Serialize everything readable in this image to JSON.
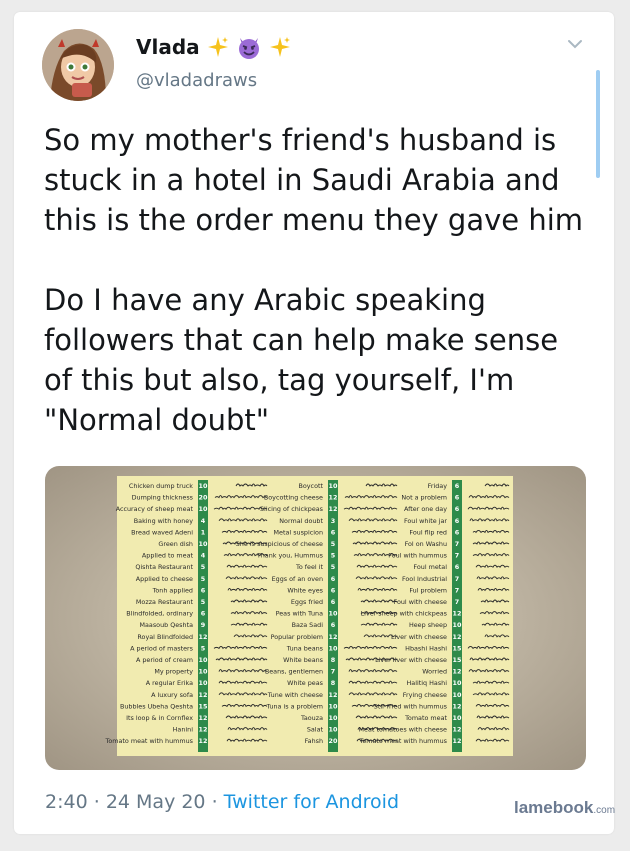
{
  "author": {
    "display_name": "Vlada",
    "handle": "@vladadraws",
    "name_emoji": [
      "sparkles",
      "smiling-imp",
      "sparkles"
    ]
  },
  "tweet": {
    "text": "So my mother's friend's husband is stuck in a hotel in Saudi Arabia and this is the order menu they gave him\n\nDo I have any Arabic speaking followers that can help make sense of this but also, tag yourself, I'm \"Normal doubt\""
  },
  "footer": {
    "time": "2:40",
    "separator1": "·",
    "date": "24 May 20",
    "separator2": "·",
    "client": "Twitter for Android"
  },
  "watermark": {
    "brand": "lamebook",
    "tld": ".com"
  },
  "menu": {
    "left": [
      {
        "en": "Chicken dump truck",
        "n": "10"
      },
      {
        "en": "Dumping thickness",
        "n": "20"
      },
      {
        "en": "Accuracy of sheep meat",
        "n": "10"
      },
      {
        "en": "Baking with honey",
        "n": "4"
      },
      {
        "en": "Bread waved Adeni",
        "n": "1"
      },
      {
        "en": "Green dish",
        "n": "10"
      },
      {
        "en": "Applied to meat",
        "n": "4"
      },
      {
        "en": "Qishta Restaurant",
        "n": "5"
      },
      {
        "en": "Applied to cheese",
        "n": "5"
      },
      {
        "en": "Tonh applied",
        "n": "6"
      },
      {
        "en": "Mozza Restaurant",
        "n": "5"
      },
      {
        "en": "Blindfolded, ordinary",
        "n": "6"
      },
      {
        "en": "Maasoub Qeshta",
        "n": "9"
      },
      {
        "en": "Royal Blindfolded",
        "n": "12"
      },
      {
        "en": "A period of masters",
        "n": "5"
      },
      {
        "en": "A period of cream",
        "n": "10"
      },
      {
        "en": "My property",
        "n": "10"
      },
      {
        "en": "A regular Erika",
        "n": "10"
      },
      {
        "en": "A luxury sofa",
        "n": "12"
      },
      {
        "en": "Bubbles Ubeha Qeshta",
        "n": "15"
      },
      {
        "en": "Its loop & in Cornflex",
        "n": "12"
      },
      {
        "en": "Hanini",
        "n": "12"
      },
      {
        "en": "Tomato meat with hummus",
        "n": "12"
      }
    ],
    "middle": [
      {
        "en": "Boycott",
        "n": "10"
      },
      {
        "en": "Boycotting cheese",
        "n": "12"
      },
      {
        "en": "Slicing of chickpeas",
        "n": "12"
      },
      {
        "en": "Normal doubt",
        "n": "3"
      },
      {
        "en": "Metal suspicion",
        "n": "6"
      },
      {
        "en": "She is suspicious of cheese",
        "n": "5"
      },
      {
        "en": "Thank you, Hummus",
        "n": "5"
      },
      {
        "en": "To feel it",
        "n": "5"
      },
      {
        "en": "Eggs of an oven",
        "n": "6"
      },
      {
        "en": "White eyes",
        "n": "6"
      },
      {
        "en": "Eggs fried",
        "n": "6"
      },
      {
        "en": "Peas with Tuna",
        "n": "10"
      },
      {
        "en": "Baza Sadi",
        "n": "6"
      },
      {
        "en": "Popular problem",
        "n": "12"
      },
      {
        "en": "Tuna beans",
        "n": "10"
      },
      {
        "en": "White beans",
        "n": "8"
      },
      {
        "en": "Beans, gentlemen",
        "n": "7"
      },
      {
        "en": "White peas",
        "n": "8"
      },
      {
        "en": "Tune with cheese",
        "n": "12"
      },
      {
        "en": "Tuna is a problem",
        "n": "10"
      },
      {
        "en": "Taouza",
        "n": "10"
      },
      {
        "en": "Salat",
        "n": "10"
      },
      {
        "en": "Fahsh",
        "n": "20"
      }
    ],
    "right": [
      {
        "en": "Friday",
        "n": "6"
      },
      {
        "en": "Not a problem",
        "n": "6"
      },
      {
        "en": "After one day",
        "n": "6"
      },
      {
        "en": "Foul white jar",
        "n": "6"
      },
      {
        "en": "Foul flip red",
        "n": "6"
      },
      {
        "en": "Fol on Washu",
        "n": "7"
      },
      {
        "en": "Foul with hummus",
        "n": "7"
      },
      {
        "en": "Foul metal",
        "n": "6"
      },
      {
        "en": "Fool Industrial",
        "n": "7"
      },
      {
        "en": "Ful problem",
        "n": "7"
      },
      {
        "en": "Foul with cheese",
        "n": "7"
      },
      {
        "en": "Liver sheep with chickpeas",
        "n": "12"
      },
      {
        "en": "Heep sheep",
        "n": "10"
      },
      {
        "en": "Liver with cheese",
        "n": "12"
      },
      {
        "en": "Hbashi Hashi",
        "n": "15"
      },
      {
        "en": "Liver liver with cheese",
        "n": "15"
      },
      {
        "en": "Worried",
        "n": "12"
      },
      {
        "en": "Halitiq Hashi",
        "n": "10"
      },
      {
        "en": "Frying cheese",
        "n": "10"
      },
      {
        "en": "Stir fried with hummus",
        "n": "12"
      },
      {
        "en": "Tomato meat",
        "n": "10"
      },
      {
        "en": "Meat tomatoes with cheese",
        "n": "12"
      },
      {
        "en": "Tomato meat with hummus",
        "n": "12"
      }
    ]
  },
  "colors": {
    "name_text": "#14171a",
    "secondary_text": "#657786",
    "link_blue": "#1b95e0",
    "menu_green": "#2e8a4a",
    "menu_paper": "#f1ebb0"
  }
}
